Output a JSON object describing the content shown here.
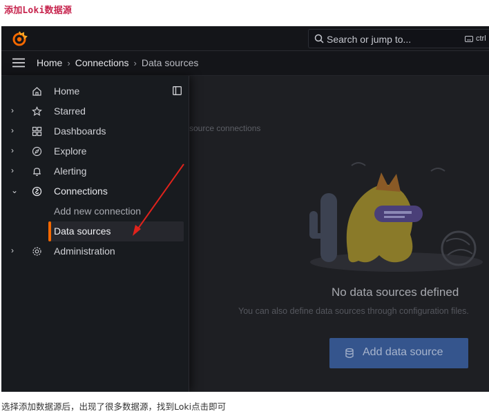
{
  "doc": {
    "heading": "添加Loki数据源",
    "caption": "选择添加数据源后，出现了很多数据源，找到Loki点击即可"
  },
  "topbar": {
    "search_placeholder": "Search or jump to...",
    "shortcut": "ctrl"
  },
  "breadcrumb": {
    "items": [
      "Home",
      "Connections",
      "Data sources"
    ],
    "separator": "›"
  },
  "sidebar": {
    "items": [
      {
        "label": "Home",
        "icon": "home-icon",
        "chevron": ""
      },
      {
        "label": "Starred",
        "icon": "star-icon",
        "chevron": "›"
      },
      {
        "label": "Dashboards",
        "icon": "apps-icon",
        "chevron": "›"
      },
      {
        "label": "Explore",
        "icon": "compass-icon",
        "chevron": "›"
      },
      {
        "label": "Alerting",
        "icon": "bell-icon",
        "chevron": "›"
      },
      {
        "label": "Connections",
        "icon": "link-icon",
        "chevron": "⌄"
      },
      {
        "label": "Add new connection",
        "icon": "",
        "chevron": ""
      },
      {
        "label": "Data sources",
        "icon": "",
        "chevron": ""
      },
      {
        "label": "Administration",
        "icon": "gear-icon",
        "chevron": "›"
      }
    ]
  },
  "main": {
    "subtitle": "source connections",
    "empty_title": "No data sources defined",
    "empty_desc": "You can also define data sources through configuration files.",
    "add_button": "Add data source"
  },
  "colors": {
    "accent": "#f46800",
    "annotation_arrow": "#e0231c",
    "primary_button": "#35558d"
  }
}
